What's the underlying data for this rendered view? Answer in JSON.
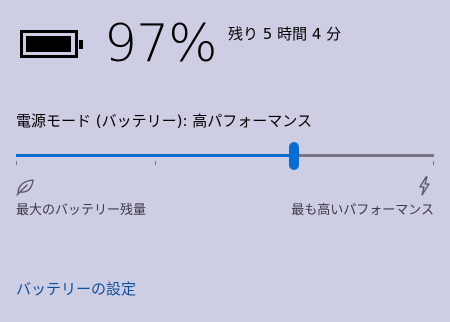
{
  "battery": {
    "percent_text": "97%",
    "level": 0.97,
    "time_remaining": "残り 5 時間 4 分"
  },
  "power_mode": {
    "heading": "電源モード (バッテリー): 高パフォーマンス",
    "slider_value": 0.665,
    "slider_ticks": [
      0,
      0.333,
      0.665,
      1
    ],
    "left_label": "最大のバッテリー残量",
    "right_label": "最も高いパフォーマンス",
    "left_icon": "leaf-icon",
    "right_icon": "lightning-bolt-icon"
  },
  "battery_settings_link": "バッテリーの設定",
  "colors": {
    "background": "#cdcde4",
    "accent": "#0a6ed1",
    "track": "#767686",
    "link": "#0e4f9c"
  }
}
